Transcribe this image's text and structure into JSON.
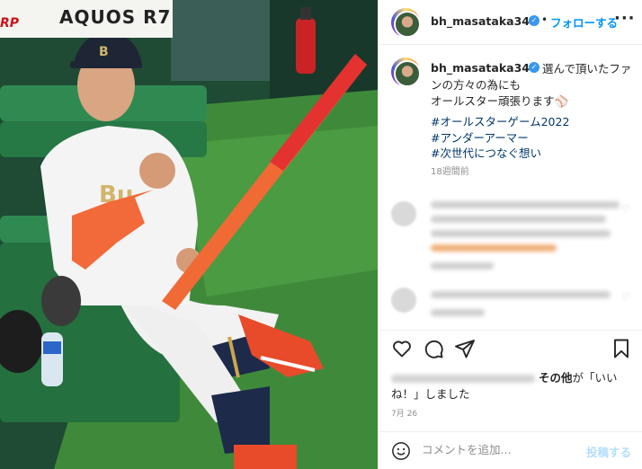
{
  "photo": {
    "banner_brand": "AQUOS R7",
    "banner_red": "RP",
    "alt": "Baseball player holding a bat in a dugout"
  },
  "header": {
    "username": "bh_masataka34",
    "verified_icon": "verified-badge-icon",
    "separator": "•",
    "follow_label": "フォローする",
    "more_label": "···"
  },
  "caption": {
    "username": "bh_masataka34",
    "text": "選んで頂いたファンの方々の為にも\nオールスター頑張ります⚾",
    "hashtags": [
      "#オールスターゲーム2022",
      "#アンダーアーマー",
      "#次世代につなぐ想い"
    ],
    "time_ago": "18週間前"
  },
  "actions": {
    "like_icon": "heart-icon",
    "comment_icon": "comment-icon",
    "share_icon": "share-icon",
    "save_icon": "bookmark-icon"
  },
  "likes": {
    "prefix_others": "その他",
    "suffix": "が「いいね！」しました"
  },
  "date": "7月 26",
  "comment_box": {
    "placeholder": "コメントを追加...",
    "post_label": "投稿する",
    "emoji_icon": "emoji-icon"
  },
  "colors": {
    "accent": "#0095f6",
    "link": "#00376b",
    "muted": "#8e8e8e"
  }
}
